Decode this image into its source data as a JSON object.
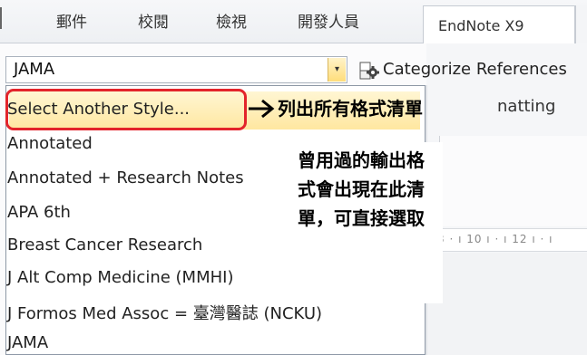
{
  "tabs": {
    "items": [
      "郵件",
      "校閱",
      "檢視",
      "開發人員"
    ],
    "active": "EndNote X9"
  },
  "style_combo": {
    "value": "JAMA",
    "arrow": "▾"
  },
  "categorize": {
    "label": "Categorize References"
  },
  "ribbon": {
    "formatting_partial": "natting",
    "ruler": "3 · ı 10 ı · ı 12 ı · ı"
  },
  "dropdown": {
    "items": [
      "Select Another Style...",
      "Annotated",
      "Annotated + Research Notes",
      "APA 6th",
      "Breast Cancer Research",
      "J Alt Comp Medicine (MMHI)",
      "J Formos Med Assoc = 臺灣醫誌 (NCKU)",
      "JAMA"
    ]
  },
  "annotations": {
    "select_note": "列出所有格式清單",
    "history_note": "曾用過的輸出格式會出現在此清單，可直接選取"
  },
  "colors": {
    "highlight_border": "#e3242b",
    "hover_bg": "#ffe7a0",
    "accent": "#d9b75d"
  },
  "icons": {
    "combo_arrow": "chevron-down-icon",
    "categorize": "categorize-gear-icon",
    "annotation_arrow": "right-arrow-icon"
  }
}
